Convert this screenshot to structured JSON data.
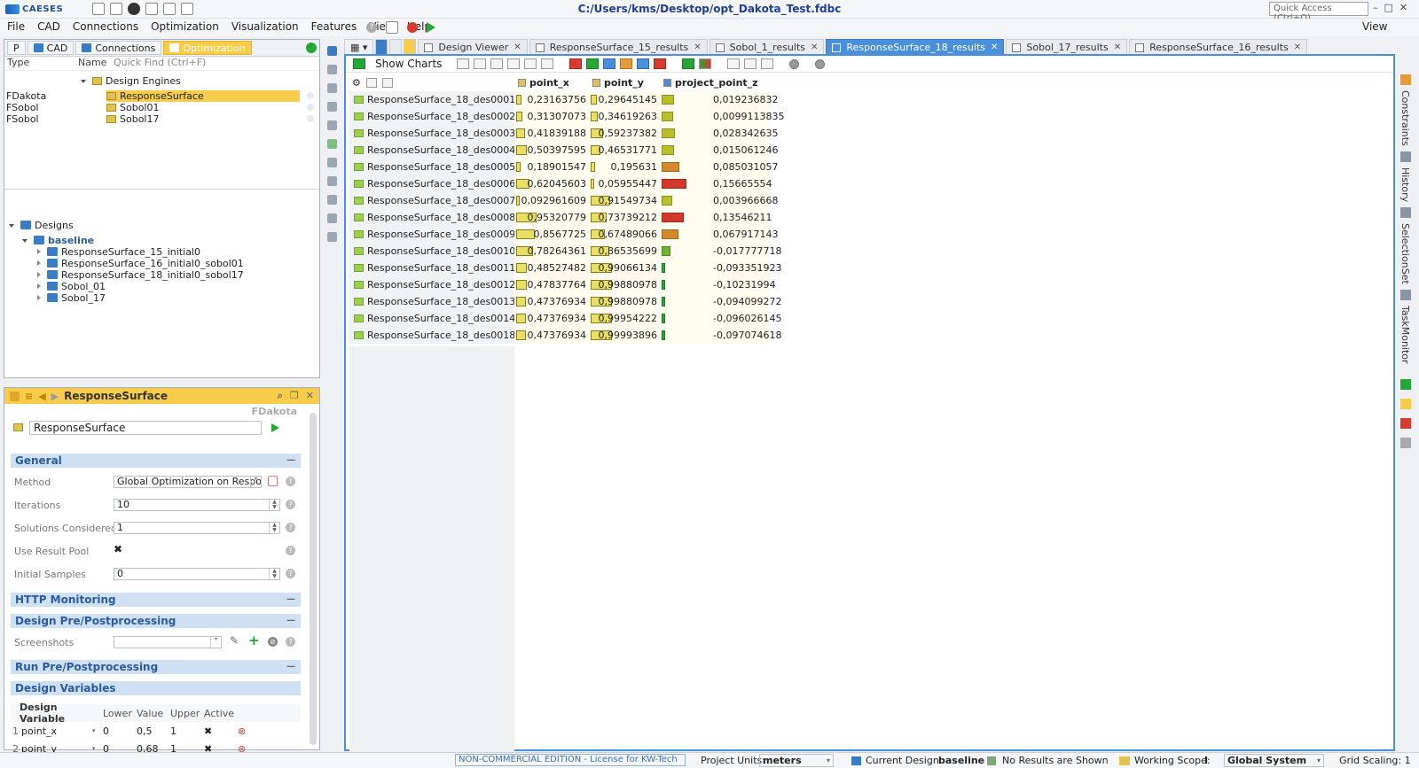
{
  "window": {
    "logo_text": "CAESES",
    "doc_title": "C:/Users/kms/Desktop/opt_Dakota_Test.fdbc",
    "quick_access_placeholder": "Quick Access (Ctrl+Q)"
  },
  "menu": [
    "File",
    "CAD",
    "Connections",
    "Optimization",
    "Visualization",
    "Features",
    "View",
    "Help"
  ],
  "menu_right": "View",
  "left_tabs": {
    "p": "P",
    "cad": "CAD",
    "connections": "Connections",
    "optimization": "Optimization"
  },
  "tree_header": {
    "type": "Type",
    "name": "Name",
    "quick_find": "Quick Find (Ctrl+F)"
  },
  "design_engines": {
    "label": "Design Engines",
    "items": [
      {
        "type": "FDakota",
        "name": "ResponseSurface"
      },
      {
        "type": "FSobol",
        "name": "Sobol01"
      },
      {
        "type": "FSobol",
        "name": "Sobol17"
      }
    ]
  },
  "designs": {
    "label": "Designs",
    "baseline": "baseline",
    "children": [
      "ResponseSurface_15_initial0",
      "ResponseSurface_16_initial0_sobol01",
      "ResponseSurface_18_initial0_sobol17",
      "Sobol_01",
      "Sobol_17"
    ]
  },
  "props": {
    "header": "ResponseSurface",
    "type_label": "FDakota",
    "name_value": "ResponseSurface",
    "sections": {
      "general": "General",
      "http": "HTTP Monitoring",
      "prepost": "Design Pre/Postprocessing",
      "runpre": "Run Pre/Postprocessing",
      "dv": "Design Variables"
    },
    "method_label": "Method",
    "method_value": "Global Optimization on Respons",
    "iterations_label": "Iterations",
    "iterations_value": "10",
    "solutions_label": "Solutions Considered",
    "solutions_value": "1",
    "pool_label": "Use Result Pool",
    "initial_label": "Initial Samples",
    "initial_value": "0",
    "screenshots_label": "Screenshots",
    "dv_headers": [
      "Design Variable",
      "Lower",
      "Value",
      "Upper",
      "Active"
    ],
    "dv_rows": [
      {
        "idx": "1",
        "name": "point_x",
        "lower": "0",
        "value": "0,5",
        "upper": "1"
      },
      {
        "idx": "2",
        "name": "point_y",
        "lower": "0",
        "value": "0,68",
        "upper": "1"
      }
    ]
  },
  "result_tabs": [
    "Design Viewer",
    "ResponseSurface_15_results",
    "Sobol_1_results",
    "ResponseSurface_18_results",
    "Sobol_17_results",
    "ResponseSurface_16_results"
  ],
  "active_tab": 3,
  "toolbar": {
    "show_charts": "Show Charts"
  },
  "columns": [
    "point_x",
    "point_y",
    "project_point_z"
  ],
  "rows": [
    {
      "name": "ResponseSurface_18_des0001",
      "x": "0,23163756",
      "xf": 0.23,
      "y": "0,29645145",
      "yf": 0.3,
      "z": "0,019236832",
      "zf": 0.25,
      "zc": "#b7c02a"
    },
    {
      "name": "ResponseSurface_18_des0002",
      "x": "0,31307073",
      "xf": 0.31,
      "y": "0,34619263",
      "yf": 0.35,
      "z": "0,0099113835",
      "zf": 0.24,
      "zc": "#b7c02a"
    },
    {
      "name": "ResponseSurface_18_des0003",
      "x": "0,41839188",
      "xf": 0.42,
      "y": "0,59237382",
      "yf": 0.59,
      "z": "0,028342635",
      "zf": 0.27,
      "zc": "#b7c02a"
    },
    {
      "name": "ResponseSurface_18_des0004",
      "x": "0,50397595",
      "xf": 0.5,
      "y": "0,46531771",
      "yf": 0.47,
      "z": "0,015061246",
      "zf": 0.25,
      "zc": "#b7c02a"
    },
    {
      "name": "ResponseSurface_18_des0005",
      "x": "0,18901547",
      "xf": 0.19,
      "y": "0,195631",
      "yf": 0.2,
      "z": "0,085031057",
      "zf": 0.37,
      "zc": "#d28a2c"
    },
    {
      "name": "ResponseSurface_18_des0006",
      "x": "0,62045603",
      "xf": 0.62,
      "y": "0,05955447",
      "yf": 0.06,
      "z": "0,15665554",
      "zf": 0.52,
      "zc": "#d3362b"
    },
    {
      "name": "ResponseSurface_18_des0007",
      "x": "0,092961609",
      "xf": 0.09,
      "y": "0,91549734",
      "yf": 0.92,
      "z": "0,003966668",
      "zf": 0.23,
      "zc": "#b7c02a"
    },
    {
      "name": "ResponseSurface_18_des0008",
      "x": "0,95320779",
      "xf": 0.95,
      "y": "0,73739212",
      "yf": 0.74,
      "z": "0,13546211",
      "zf": 0.47,
      "zc": "#d3362b"
    },
    {
      "name": "ResponseSurface_18_des0009",
      "x": "0,8567725",
      "xf": 0.86,
      "y": "0,67489066",
      "yf": 0.67,
      "z": "0,067917143",
      "zf": 0.35,
      "zc": "#d28a2c"
    },
    {
      "name": "ResponseSurface_18_des0010",
      "x": "0,78264361",
      "xf": 0.78,
      "y": "0,86535699",
      "yf": 0.87,
      "z": "-0,017777718",
      "zf": 0.19,
      "zc": "#6cb52c"
    },
    {
      "name": "ResponseSurface_18_des0011",
      "x": "0,48527482",
      "xf": 0.49,
      "y": "0,99066134",
      "yf": 0.99,
      "z": "-0,093351923",
      "zf": 0.06,
      "zc": "#23a835"
    },
    {
      "name": "ResponseSurface_18_des0012",
      "x": "0,47837764",
      "xf": 0.48,
      "y": "0,99880978",
      "yf": 1.0,
      "z": "-0,10231994",
      "zf": 0.05,
      "zc": "#23a835"
    },
    {
      "name": "ResponseSurface_18_des0013",
      "x": "0,47376934",
      "xf": 0.47,
      "y": "0,99880978",
      "yf": 1.0,
      "z": "-0,094099272",
      "zf": 0.06,
      "zc": "#23a835"
    },
    {
      "name": "ResponseSurface_18_des0014",
      "x": "0,47376934",
      "xf": 0.47,
      "y": "0,99954222",
      "yf": 1.0,
      "z": "-0,096026145",
      "zf": 0.06,
      "zc": "#23a835"
    },
    {
      "name": "ResponseSurface_18_des0018",
      "x": "0,47376934",
      "xf": 0.47,
      "y": "0,99993896",
      "yf": 1.0,
      "z": "-0,097074618",
      "zf": 0.06,
      "zc": "#23a835"
    }
  ],
  "right_panel": [
    "Constraints",
    "History",
    "SelectionSet",
    "TaskMonitor"
  ],
  "status": {
    "license": "NON-COMMERCIAL EDITION - License for KW-Tech",
    "units_label": "Project Units:",
    "units_value": "meters",
    "current_design_label": "Current Design:",
    "current_design_value": "baseline",
    "results_shown": "No Results are Shown",
    "scope_label": "Working Scope:",
    "scope_value": "I",
    "system_value": "Global System",
    "grid_scaling": "Grid Scaling: 1"
  }
}
